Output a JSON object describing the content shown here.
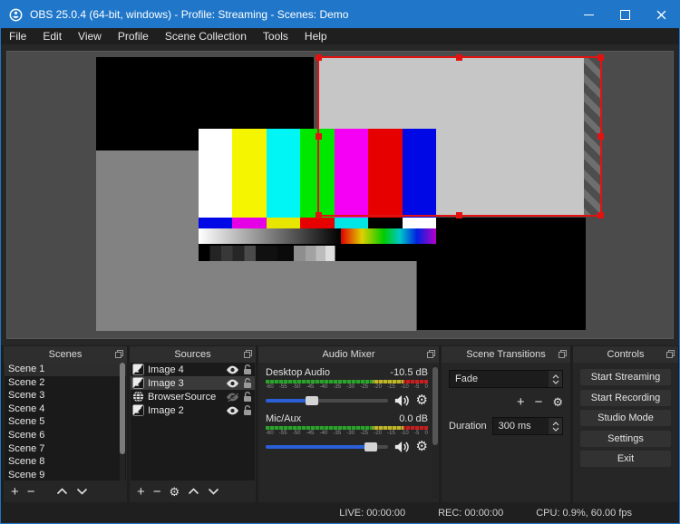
{
  "window": {
    "title": "OBS 25.0.4 (64-bit, windows) - Profile: Streaming - Scenes: Demo"
  },
  "menu": {
    "items": [
      "File",
      "Edit",
      "View",
      "Profile",
      "Scene Collection",
      "Tools",
      "Help"
    ]
  },
  "scenes": {
    "title": "Scenes",
    "selected": "Scene 1",
    "items": [
      "Scene 1",
      "Scene 2",
      "Scene 3",
      "Scene 4",
      "Scene 5",
      "Scene 6",
      "Scene 7",
      "Scene 8",
      "Scene 9"
    ]
  },
  "sources": {
    "title": "Sources",
    "selected": "Image 3",
    "items": [
      {
        "label": "Image 4",
        "type": "image",
        "visible": true,
        "locked": false
      },
      {
        "label": "Image 3",
        "type": "image",
        "visible": true,
        "locked": false
      },
      {
        "label": "BrowserSource",
        "type": "browser",
        "visible": false,
        "locked": false
      },
      {
        "label": "Image 2",
        "type": "image",
        "visible": true,
        "locked": false
      }
    ]
  },
  "mixer": {
    "title": "Audio Mixer",
    "ticks": [
      "-60",
      "-55",
      "-50",
      "-45",
      "-40",
      "-35",
      "-30",
      "-25",
      "-20",
      "-15",
      "-10",
      "-5",
      "0"
    ],
    "channels": [
      {
        "name": "Desktop Audio",
        "level": "-10.5 dB",
        "volume_pct": 38
      },
      {
        "name": "Mic/Aux",
        "level": "0.0 dB",
        "volume_pct": 86
      }
    ]
  },
  "transitions": {
    "title": "Scene Transitions",
    "current": "Fade",
    "duration_label": "Duration",
    "duration_value": "300 ms"
  },
  "controls": {
    "title": "Controls",
    "buttons": [
      "Start Streaming",
      "Start Recording",
      "Studio Mode",
      "Settings",
      "Exit"
    ]
  },
  "status": {
    "live": "LIVE: 00:00:00",
    "rec": "REC: 00:00:00",
    "cpu": "CPU: 0.9%, 60.00 fps"
  },
  "colors": {
    "titlebar_blue": "#2077c9",
    "selection_red": "#e11212",
    "volume_blue": "#2a5fd8",
    "meter_green": "#2da12d",
    "meter_yellow": "#c0b62a",
    "meter_red": "#c32222"
  }
}
